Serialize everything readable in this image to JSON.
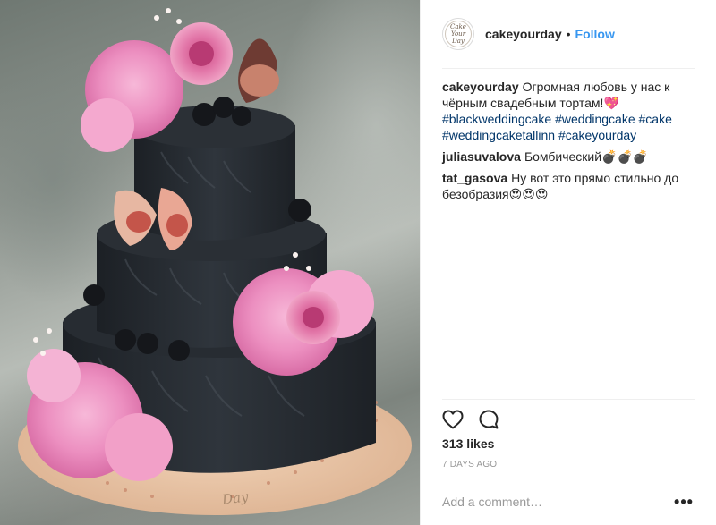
{
  "post": {
    "author": {
      "username": "cakeyourday",
      "avatar_text": "Cake Your Day"
    },
    "separator_dot": "•",
    "follow_label": "Follow",
    "image": {
      "watermark_text": "Day"
    },
    "comments": [
      {
        "user": "cakeyourday",
        "text": "Огромная любовь у нас к чёрным свадебным тортам!💖",
        "hashtags": [
          "#blackweddingcake",
          "#weddingcake",
          "#cake",
          "#weddingcaketallinn",
          "#cakeyourday"
        ]
      },
      {
        "user": "juliasuvalova",
        "text": "Бомбический💣💣💣"
      },
      {
        "user": "tat_gasova",
        "text": "Ну вот это прямо стильно до безобразия😍😍😍"
      }
    ],
    "likes_label": "313 likes",
    "timestamp": "7 DAYS AGO",
    "add_comment_placeholder": "Add a comment…",
    "more_options": "•••",
    "icons": {
      "like": "heart-outline-icon",
      "comment": "speech-bubble-icon",
      "more": "ellipsis-icon"
    },
    "colors": {
      "link_blue": "#3897f0",
      "hashtag": "#003569",
      "text": "#262626",
      "muted": "#999999"
    }
  }
}
